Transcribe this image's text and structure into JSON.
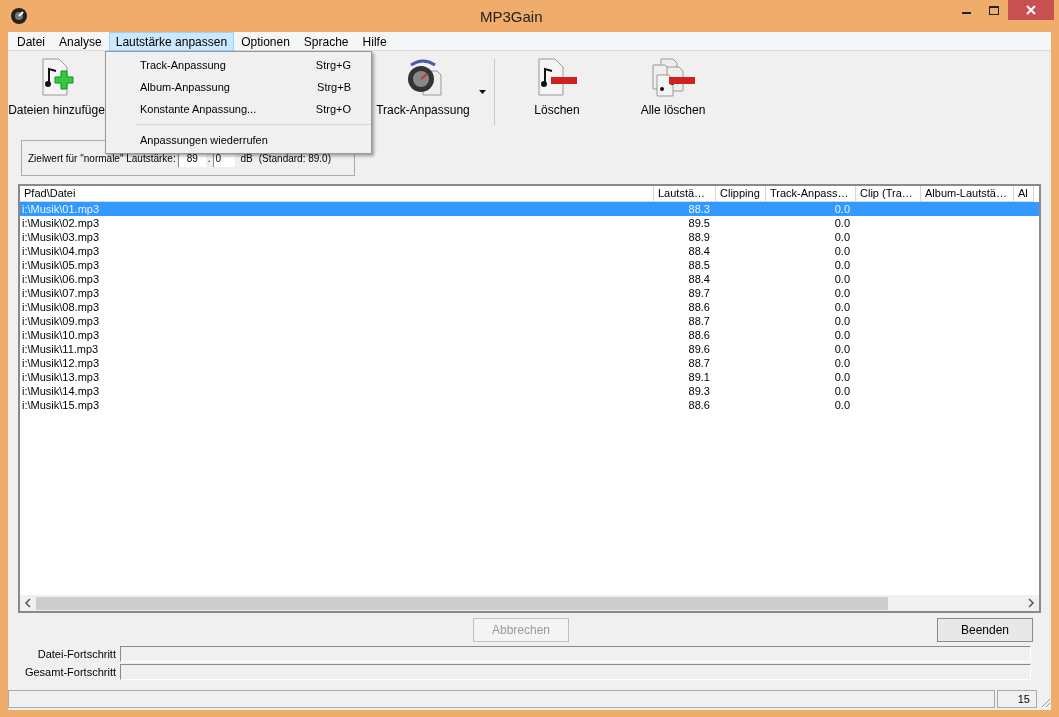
{
  "window": {
    "title": "MP3Gain"
  },
  "menu_bar": [
    {
      "label": "Datei",
      "selected": false
    },
    {
      "label": "Analyse",
      "selected": false
    },
    {
      "label": "Lautstärke anpassen",
      "selected": true
    },
    {
      "label": "Optionen",
      "selected": false
    },
    {
      "label": "Sprache",
      "selected": false
    },
    {
      "label": "Hilfe",
      "selected": false
    }
  ],
  "open_menu": {
    "items": [
      {
        "label": "Track-Anpassung",
        "shortcut": "Strg+G"
      },
      {
        "label": "Album-Anpassung",
        "shortcut": "Strg+B"
      },
      {
        "label": "Konstante Anpassung...",
        "shortcut": "Strg+O"
      },
      {
        "kind": "separator"
      },
      {
        "label": "Anpassungen wiederrufen"
      }
    ]
  },
  "toolbar": [
    {
      "label": "Dateien hinzufüge",
      "kind": "add"
    },
    {
      "label": "Track-Anpassung",
      "kind": "gain",
      "dropdown": true
    },
    {
      "label": "Löschen",
      "kind": "delete"
    },
    {
      "label": "Alle löschen",
      "kind": "delete_all"
    }
  ],
  "target": {
    "label": "Zielwert für \"normale\" Lautstärke:",
    "integer": "89",
    "separator": ".",
    "decimal": "0",
    "unit": "dB",
    "standard": "(Standard: 89.0)"
  },
  "table": {
    "columns": [
      "Pfad\\Datei",
      "Lautstä…",
      "Clipping",
      "Track-Anpass…",
      "Clip (Tra…",
      "Album-Lautstä…",
      "Al"
    ],
    "rows": [
      {
        "path": "i:\\Musik\\01.mp3",
        "volume": "88.3",
        "track_gain": "0.0",
        "selected": true
      },
      {
        "path": "i:\\Musik\\02.mp3",
        "volume": "89.5",
        "track_gain": "0.0",
        "selected": false
      },
      {
        "path": "i:\\Musik\\03.mp3",
        "volume": "88.9",
        "track_gain": "0.0",
        "selected": false
      },
      {
        "path": "i:\\Musik\\04.mp3",
        "volume": "88.4",
        "track_gain": "0.0",
        "selected": false
      },
      {
        "path": "i:\\Musik\\05.mp3",
        "volume": "88.5",
        "track_gain": "0.0",
        "selected": false
      },
      {
        "path": "i:\\Musik\\06.mp3",
        "volume": "88.4",
        "track_gain": "0.0",
        "selected": false
      },
      {
        "path": "i:\\Musik\\07.mp3",
        "volume": "89.7",
        "track_gain": "0.0",
        "selected": false
      },
      {
        "path": "i:\\Musik\\08.mp3",
        "volume": "88.6",
        "track_gain": "0.0",
        "selected": false
      },
      {
        "path": "i:\\Musik\\09.mp3",
        "volume": "88.7",
        "track_gain": "0.0",
        "selected": false
      },
      {
        "path": "i:\\Musik\\10.mp3",
        "volume": "88.6",
        "track_gain": "0.0",
        "selected": false
      },
      {
        "path": "i:\\Musik\\11.mp3",
        "volume": "89.6",
        "track_gain": "0.0",
        "selected": false
      },
      {
        "path": "i:\\Musik\\12.mp3",
        "volume": "88.7",
        "track_gain": "0.0",
        "selected": false
      },
      {
        "path": "i:\\Musik\\13.mp3",
        "volume": "89.1",
        "track_gain": "0.0",
        "selected": false
      },
      {
        "path": "i:\\Musik\\14.mp3",
        "volume": "89.3",
        "track_gain": "0.0",
        "selected": false
      },
      {
        "path": "i:\\Musik\\15.mp3",
        "volume": "88.6",
        "track_gain": "0.0",
        "selected": false
      }
    ]
  },
  "buttons": [
    {
      "label": "Abbrechen",
      "disabled": true
    },
    {
      "label": "Beenden",
      "disabled": false
    }
  ],
  "progress": [
    {
      "label": "Datei-Fortschritt",
      "level": 0
    },
    {
      "label": "Gesamt-Fortschritt",
      "level": 0
    }
  ],
  "status_bar": {
    "count": "15"
  }
}
